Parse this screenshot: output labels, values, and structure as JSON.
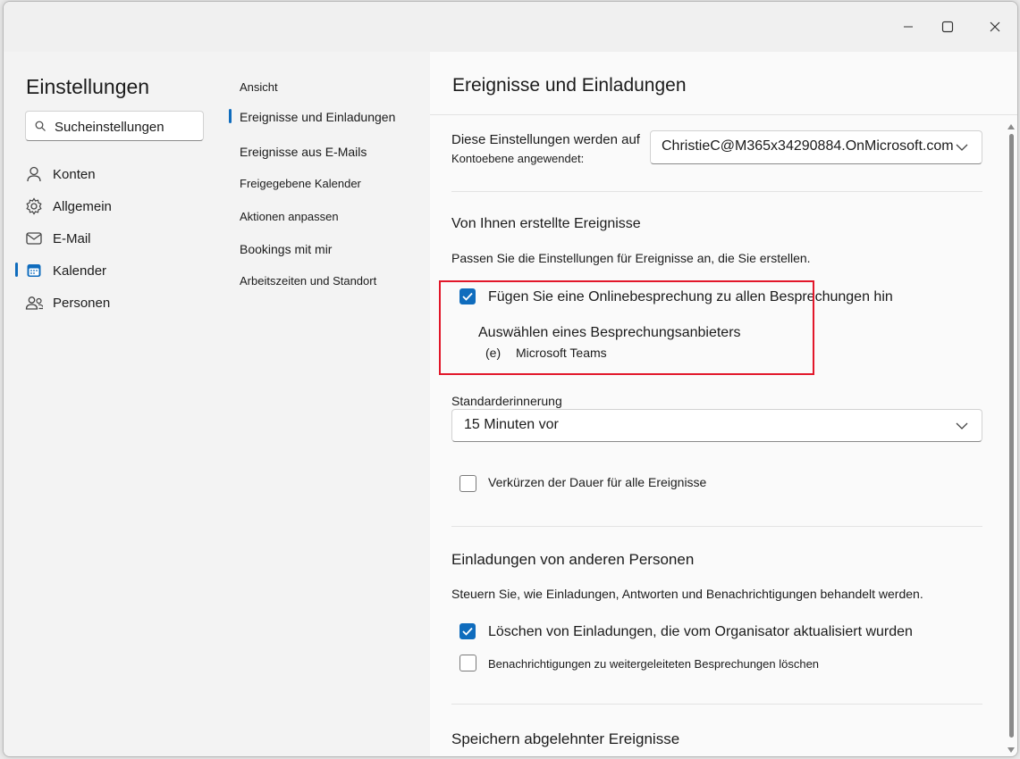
{
  "window": {
    "controls": {
      "minimize": "minimize-icon",
      "maximize": "maximize-icon",
      "close": "close-icon"
    }
  },
  "sidebar": {
    "title": "Einstellungen",
    "search_placeholder": "Sucheinstellungen",
    "items": [
      {
        "label": "Konten",
        "icon": "person-icon"
      },
      {
        "label": "Allgemein",
        "icon": "gear-icon"
      },
      {
        "label": "E-Mail",
        "icon": "mail-icon"
      },
      {
        "label": "Kalender",
        "icon": "calendar-icon",
        "selected": true
      },
      {
        "label": "Personen",
        "icon": "people-icon"
      }
    ]
  },
  "subnav": {
    "items": [
      {
        "label": "Ansicht"
      },
      {
        "label": "Ereignisse und Einladungen",
        "selected": true
      },
      {
        "label": "Ereignisse aus E-Mails"
      },
      {
        "label": "Freigegebene Kalender"
      },
      {
        "label": "Aktionen anpassen"
      },
      {
        "label": "Bookings mit mir"
      },
      {
        "label": "Arbeitszeiten und Standort"
      }
    ]
  },
  "content": {
    "title": "Ereignisse und Einladungen",
    "account_label_line1": "Diese Einstellungen werden auf",
    "account_label_line2": "Kontoebene angewendet:",
    "account_value": "ChristieC@M365x34290884.OnMicrosoft.com",
    "own_events_heading": "Von Ihnen erstellte Ereignisse",
    "own_events_desc": "Passen Sie die Einstellungen für Ereignisse an, die Sie erstellen.",
    "online_meeting_label": "Fügen Sie eine Onlinebesprechung zu allen Besprechungen hin",
    "online_meeting_checked": true,
    "provider_label": "Auswählen eines Besprechungsanbieters",
    "provider_marker": "(e)",
    "provider_value": "Microsoft Teams",
    "reminder_label": "Standarderinnerung",
    "reminder_value": "15 Minuten vor",
    "shorten_label": "Verkürzen der Dauer für alle Ereignisse",
    "shorten_checked": false,
    "invites_heading": "Einladungen von anderen Personen",
    "invites_desc": "Steuern Sie, wie Einladungen, Antworten und Benachrichtigungen behandelt werden.",
    "delete_updated_label": "Löschen von Einladungen, die vom Organisator aktualisiert wurden",
    "delete_updated_checked": true,
    "delete_forward_label": "Benachrichtigungen zu weitergeleiteten Besprechungen löschen",
    "delete_forward_checked": false,
    "declined_heading": "Speichern abgelehnter Ereignisse"
  },
  "colors": {
    "accent": "#0f6cbd",
    "highlight": "#e2172a"
  }
}
